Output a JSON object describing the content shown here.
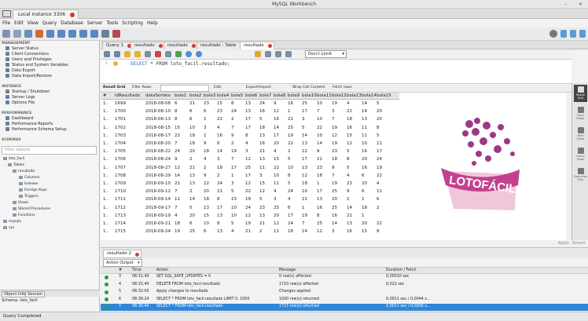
{
  "window": {
    "title": "MySQL Workbench"
  },
  "connection_tab": {
    "label": "Local instance 3306"
  },
  "menu": [
    "File",
    "Edit",
    "View",
    "Query",
    "Database",
    "Server",
    "Tools",
    "Scripting",
    "Help"
  ],
  "sidebar": {
    "management": {
      "heading": "MANAGEMENT",
      "items": [
        "Server Status",
        "Client Connections",
        "Users and Privileges",
        "Status and System Variables",
        "Data Export",
        "Data Import/Restore"
      ]
    },
    "instance": {
      "heading": "INSTANCE",
      "items": [
        "Startup / Shutdown",
        "Server Logs",
        "Options File"
      ]
    },
    "performance": {
      "heading": "PERFORMANCE",
      "items": [
        "Dashboard",
        "Performance Reports",
        "Performance Schema Setup"
      ]
    },
    "schemas": {
      "heading": "SCHEMAS",
      "filter_placeholder": "Filter objects"
    },
    "tree": [
      "loto_facil",
      "Tables",
      "resultado",
      "Columns",
      "Indexes",
      "Foreign Keys",
      "Triggers",
      "Views",
      "Stored Procedures",
      "Functions",
      "mysqlv",
      "sys"
    ],
    "bottom_tabs": [
      "Object Info",
      "Session"
    ],
    "schema_info": "Schema: loto_facil"
  },
  "query_tabs": [
    "Query 1",
    "resultado",
    "resultado",
    "resultado - Table",
    "resultado"
  ],
  "editor": {
    "limit": "Don't Limit",
    "line": "1",
    "sql_kw": "SELECT",
    "sql_rest": " * FROM loto_facil.resultado;"
  },
  "result_bar": {
    "result_grid": "Result Grid",
    "filter_rows": "Filter Rows:",
    "edit": "Edit:",
    "export_import": "Export/Import:",
    "wrap": "Wrap Cell Content:",
    "fetch": "Fetch rows:"
  },
  "grid": {
    "columns": [
      "#",
      "idResultado",
      "dataSorteio",
      "bola1",
      "bola2",
      "bola3",
      "bola4",
      "bola5",
      "bola6",
      "bola7",
      "bola8",
      "bola9",
      "bola10",
      "bola11",
      "bola12",
      "bola13",
      "bola14",
      "bola15"
    ],
    "rows": [
      [
        "1..",
        "1699",
        "2018-08-08",
        "6",
        "21",
        "23",
        "15",
        "8",
        "13",
        "24",
        "9",
        "16",
        "25",
        "10",
        "19",
        "4",
        "14",
        "5"
      ],
      [
        "1..",
        "1700",
        "2018-08-10",
        "8",
        "6",
        "6",
        "23",
        "24",
        "13",
        "16",
        "12",
        "1",
        "17",
        "7",
        "3",
        "22",
        "14",
        "20"
      ],
      [
        "1..",
        "1701",
        "2018-08-13",
        "8",
        "6",
        "1",
        "22",
        "2",
        "17",
        "5",
        "16",
        "21",
        "3",
        "10",
        "7",
        "18",
        "13",
        "20"
      ],
      [
        "1..",
        "1702",
        "2018-08-15",
        "15",
        "10",
        "3",
        "4",
        "7",
        "17",
        "18",
        "14",
        "25",
        "5",
        "22",
        "19",
        "16",
        "11",
        "8"
      ],
      [
        "1..",
        "1703",
        "2018-08-17",
        "22",
        "18",
        "1",
        "16",
        "9",
        "8",
        "13",
        "17",
        "19",
        "14",
        "10",
        "12",
        "15",
        "11",
        "5"
      ],
      [
        "1..",
        "1704",
        "2018-08-20",
        "7",
        "18",
        "9",
        "6",
        "2",
        "4",
        "16",
        "20",
        "22",
        "13",
        "14",
        "19",
        "12",
        "10",
        "11"
      ],
      [
        "1..",
        "1705",
        "2018-08-22",
        "24",
        "20",
        "18",
        "14",
        "19",
        "3",
        "21",
        "4",
        "2",
        "12",
        "9",
        "23",
        "5",
        "16",
        "17"
      ],
      [
        "1..",
        "1706",
        "2018-08-24",
        "9",
        "2",
        "4",
        "3",
        "7",
        "12",
        "13",
        "15",
        "5",
        "17",
        "21",
        "18",
        "8",
        "20",
        "24"
      ],
      [
        "1..",
        "1707",
        "2018-08-27",
        "12",
        "21",
        "2",
        "18",
        "17",
        "25",
        "11",
        "22",
        "10",
        "13",
        "23",
        "9",
        "5",
        "16",
        "19"
      ],
      [
        "1..",
        "1708",
        "2018-08-29",
        "14",
        "13",
        "9",
        "2",
        "1",
        "17",
        "3",
        "10",
        "8",
        "12",
        "18",
        "7",
        "4",
        "6",
        "22"
      ],
      [
        "1..",
        "1709",
        "2018-09-10",
        "21",
        "13",
        "22",
        "24",
        "3",
        "12",
        "15",
        "11",
        "5",
        "18",
        "1",
        "19",
        "23",
        "20",
        "4"
      ],
      [
        "1..",
        "1710",
        "2018-09-12",
        "7",
        "2",
        "20",
        "21",
        "5",
        "22",
        "12",
        "4",
        "24",
        "10",
        "17",
        "25",
        "9",
        "6",
        "11"
      ],
      [
        "1..",
        "1711",
        "2018-09-14",
        "11",
        "14",
        "18",
        "8",
        "23",
        "19",
        "5",
        "3",
        "4",
        "21",
        "13",
        "20",
        "2",
        "1",
        "6"
      ],
      [
        "1..",
        "1712",
        "2018-09-17",
        "7",
        "5",
        "13",
        "17",
        "10",
        "24",
        "23",
        "25",
        "6",
        "1",
        "16",
        "25",
        "14",
        "18",
        "2"
      ],
      [
        "1..",
        "1713",
        "2018-09-19",
        "4",
        "20",
        "15",
        "13",
        "10",
        "12",
        "13",
        "20",
        "17",
        "19",
        "8",
        "16",
        "21",
        "1",
        ""
      ],
      [
        "1..",
        "1714",
        "2018-09-21",
        "18",
        "6",
        "10",
        "8",
        "5",
        "19",
        "21",
        "12",
        "24",
        "7",
        "25",
        "14",
        "13",
        "20",
        "22"
      ],
      [
        "1..",
        "1715",
        "2018-09-24",
        "19",
        "25",
        "6",
        "13",
        "4",
        "21",
        "2",
        "11",
        "18",
        "14",
        "12",
        "3",
        "16",
        "15",
        "8"
      ]
    ]
  },
  "right_panel": [
    "Result Grid",
    "Form Editor",
    "Field Types",
    "Query Stats",
    "Execution Plan"
  ],
  "apply_bar": {
    "apply": "Apply",
    "revert": "Revert"
  },
  "output": {
    "tab": "resultado 2",
    "selector": "Action Output",
    "headers": [
      "#",
      "Time",
      "Action",
      "Message",
      "Duration / Fetch"
    ],
    "rows": [
      [
        "3",
        "08:31:40",
        "SET SQL_SAFE_UPDATES = 0",
        "0 row(s) affected",
        "0,00010 sec"
      ],
      [
        "4",
        "08:31:40",
        "DELETE FROM loto_facil.resultado",
        "1710 row(s) affected",
        "0,022 sec"
      ],
      [
        "5",
        "08:32:00",
        "Apply changes to resultado",
        "Changes applied",
        ""
      ],
      [
        "6",
        "08:36:24",
        "SELECT * FROM loto_facil.resultado LIMIT 0, 1000",
        "1000 row(s) returned",
        "0,0011 sec / 0,0044 s..."
      ],
      [
        "7",
        "08:36:40",
        "SELECT * FROM loto_facil.resultado",
        "1715 row(s) returned",
        "0,0011 sec / 0,0056 s..."
      ]
    ]
  },
  "status": "Query Completed",
  "logo": "LOTOFÁCIL"
}
